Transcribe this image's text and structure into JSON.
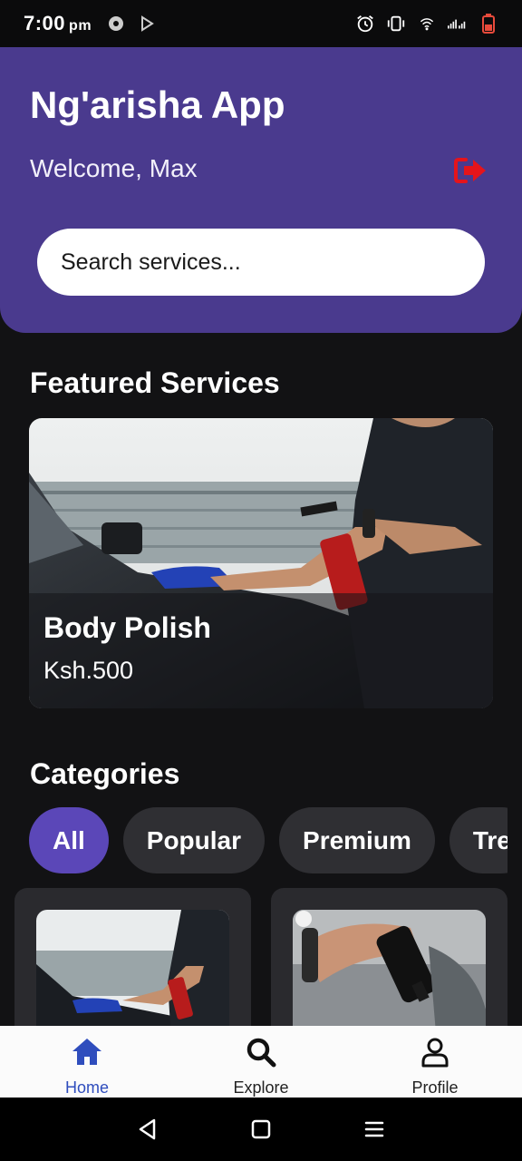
{
  "status_bar": {
    "time": "7:00",
    "ampm": "pm"
  },
  "header": {
    "title": "Ng'arisha App",
    "welcome": "Welcome, Max",
    "search_placeholder": "Search services..."
  },
  "featured": {
    "heading": "Featured Services",
    "card": {
      "name": "Body Polish",
      "price": "Ksh.500"
    }
  },
  "categories": {
    "heading": "Categories",
    "chips": [
      {
        "label": "All",
        "active": true
      },
      {
        "label": "Popular",
        "active": false
      },
      {
        "label": "Premium",
        "active": false
      },
      {
        "label": "Tre",
        "active": false
      }
    ]
  },
  "bottom_nav": {
    "items": [
      {
        "label": "Home",
        "icon": "home-icon",
        "active": true
      },
      {
        "label": "Explore",
        "icon": "search-icon",
        "active": false
      },
      {
        "label": "Profile",
        "icon": "profile-icon",
        "active": false
      }
    ]
  },
  "colors": {
    "header_bg": "#4a3a8e",
    "chip_active": "#5b47b8",
    "nav_active": "#2f4dbd",
    "logout_icon": "#e5141b"
  }
}
